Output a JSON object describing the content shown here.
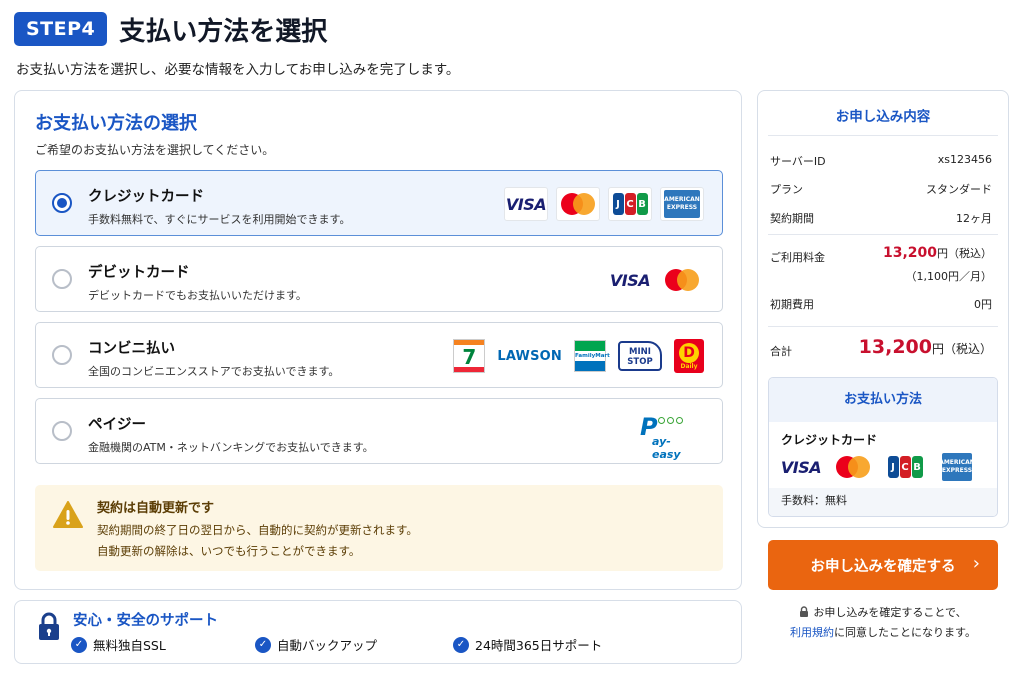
{
  "header": {
    "step": "STEP4",
    "title": "支払い方法を選択",
    "subtitle": "お支払い方法を選択し、必要な情報を入力してお申し込みを完了します。"
  },
  "payment_section": {
    "title": "お支払い方法の選択",
    "subtitle": "ご希望のお支払い方法を選択してください。",
    "selected": "credit",
    "options": [
      {
        "id": "credit",
        "name": "クレジットカード",
        "desc": "手数料無料で、すぐにサービスを利用開始できます。",
        "logos": [
          "visa-logo",
          "mastercard-logo",
          "jcb-logo",
          "amex-logo"
        ]
      },
      {
        "id": "debit",
        "name": "デビットカード",
        "desc": "デビットカードでもお支払いいただけます。",
        "logos": [
          "visa-logo",
          "mastercard-logo"
        ]
      },
      {
        "id": "konbini",
        "name": "コンビニ払い",
        "desc": "全国のコンビニエンスストアでお支払いできます。",
        "logos": [
          "seven-eleven-logo",
          "lawson-logo",
          "familymart-logo",
          "ministop-logo",
          "daily-yamazaki-logo"
        ]
      },
      {
        "id": "payeasy",
        "name": "ペイジー",
        "desc": "金融機関のATM・ネットバンキングでお支払いできます。",
        "logos": [
          "pay-easy-logo"
        ]
      }
    ]
  },
  "brand_text": {
    "visa": "VISA",
    "jcb": [
      "J",
      "C",
      "B"
    ],
    "amex_1": "AMERICAN",
    "amex_2": "EXPRESS",
    "seven_eleven": "7",
    "lawson": "LAWSON",
    "familymart": "FamilyMart",
    "ministop_1": "MINI",
    "ministop_2": "STOP",
    "daily_1": "D",
    "daily_2": "Daily",
    "payeasy_p": "P",
    "payeasy_rest": "ay-easy"
  },
  "notice": {
    "title": "契約は自動更新です",
    "line1": "契約期間の終了日の翌日から、自動的に契約が更新されます。",
    "line2": "自動更新の解除は、いつでも行うことができます。"
  },
  "support": {
    "title": "安心・安全のサポート",
    "items": [
      "無料独自SSL",
      "自動バックアップ",
      "24時間365日サポート"
    ]
  },
  "summary": {
    "title": "お申し込み内容",
    "server_id_label": "サーバーID",
    "server_id": "xs123456",
    "plan_label": "プラン",
    "plan": "スタンダード",
    "period_label": "契約期間",
    "period": "12ヶ月",
    "fee_label": "ご利用料金",
    "fee": "13,200",
    "fee_unit": "円（税込）",
    "fee_monthly": "（1,100円／月）",
    "initial_label": "初期費用",
    "initial": "0円",
    "total_label": "合計",
    "total": "13,200",
    "total_unit": "円（税込）",
    "payment_title": "お支払い方法",
    "payment_name": "クレジットカード",
    "payment_fee": "手数料：無料"
  },
  "cta": {
    "label": "お申し込みを確定する",
    "arrow": "›",
    "note1": "お申し込みを確定することで、",
    "terms_link": "利用規約",
    "note2": "に同意したことになります。"
  },
  "colors": {
    "primary": "#1a56c4",
    "accent_orange": "#ea6510",
    "price_red": "#c8102e",
    "notice_bg": "#fdf6e4"
  }
}
